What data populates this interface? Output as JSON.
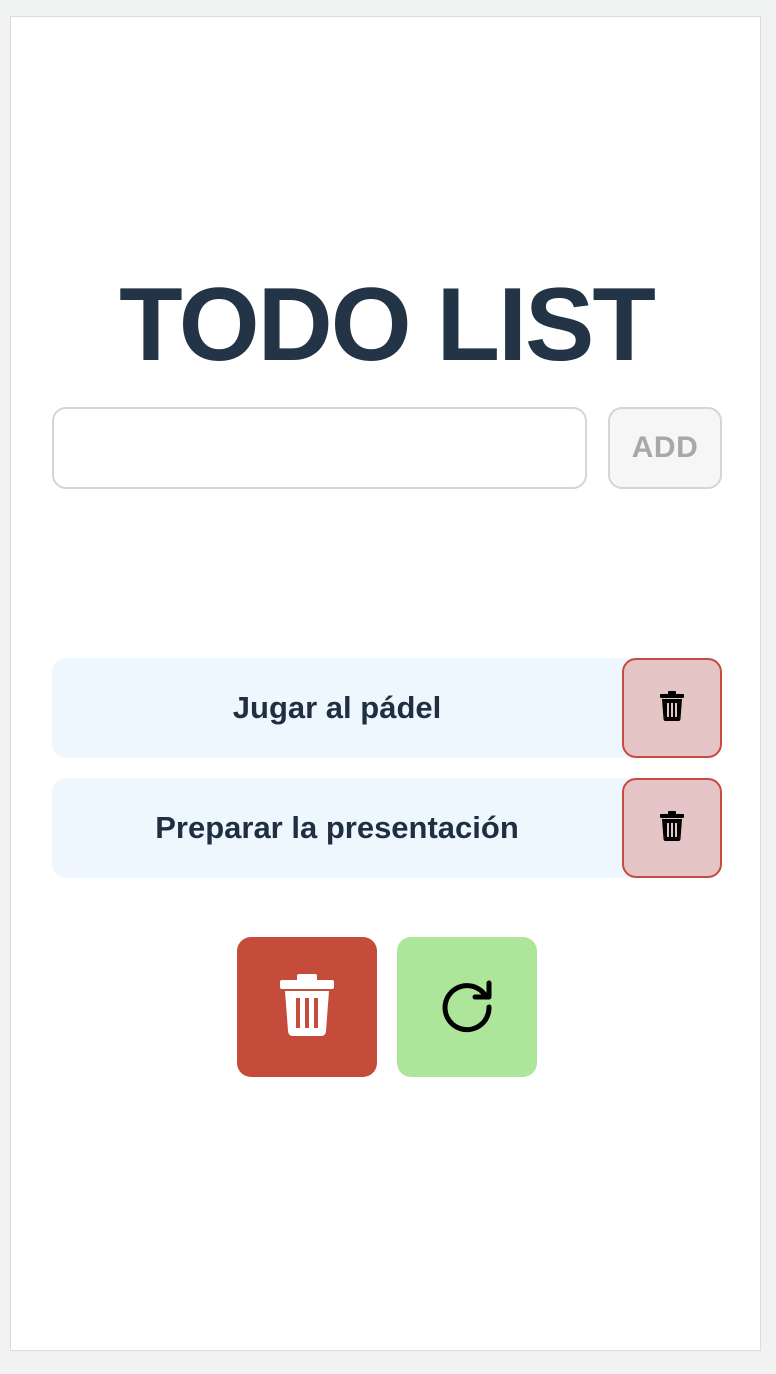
{
  "app": {
    "title": "TODO LIST"
  },
  "form": {
    "input_value": "",
    "input_placeholder": "",
    "add_label": "ADD"
  },
  "todos": [
    {
      "label": "Jugar al pádel",
      "delete_icon": "trash-icon"
    },
    {
      "label": "Preparar la presentación",
      "delete_icon": "trash-icon"
    }
  ],
  "actions": {
    "clear_all_icon": "trash-icon",
    "reset_icon": "refresh-icon"
  },
  "colors": {
    "title": "#233446",
    "item_background": "#eef6fe",
    "item_delete_background": "#e4c4c4",
    "item_delete_border": "#c74b3c",
    "clear_all_background": "#c54b3a",
    "reset_background": "#ade59a",
    "add_text": "#a8a8a8"
  }
}
